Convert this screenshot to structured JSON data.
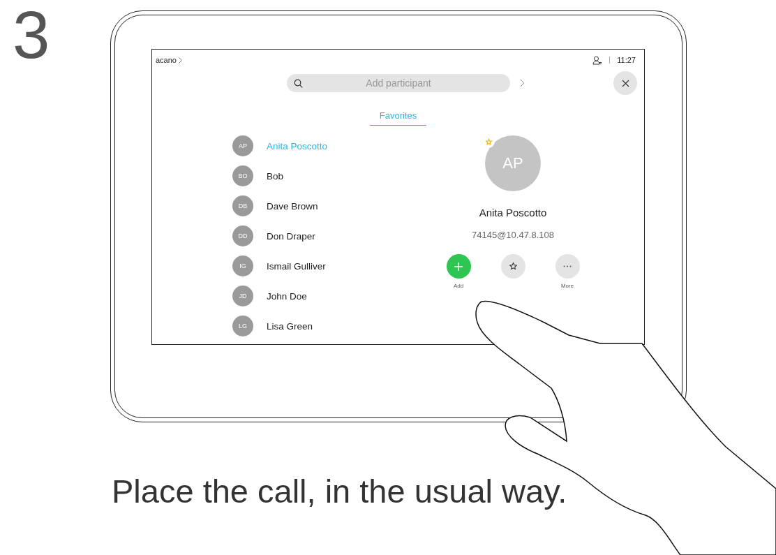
{
  "step_number": "3",
  "screen": {
    "breadcrumb": "acano",
    "time": "11:27",
    "search": {
      "placeholder": "Add participant"
    },
    "tabs": [
      {
        "label": "Favorites",
        "selected": true
      }
    ],
    "contacts": [
      {
        "initials": "AP",
        "name": "Anita Poscotto",
        "selected": true
      },
      {
        "initials": "BO",
        "name": "Bob",
        "selected": false
      },
      {
        "initials": "DB",
        "name": "Dave Brown",
        "selected": false
      },
      {
        "initials": "DD",
        "name": "Don Draper",
        "selected": false
      },
      {
        "initials": "IG",
        "name": "Ismail Gulliver",
        "selected": false
      },
      {
        "initials": "JD",
        "name": "John Doe",
        "selected": false
      },
      {
        "initials": "LG",
        "name": "Lisa Green",
        "selected": false
      }
    ],
    "detail": {
      "initials": "AP",
      "favorite": true,
      "name": "Anita Poscotto",
      "address": "74145@10.47.8.108",
      "actions": [
        {
          "kind": "add",
          "label": "Add"
        },
        {
          "kind": "favorite"
        },
        {
          "kind": "more",
          "label": "More"
        }
      ]
    }
  },
  "caption": "Place the call, in the usual way."
}
